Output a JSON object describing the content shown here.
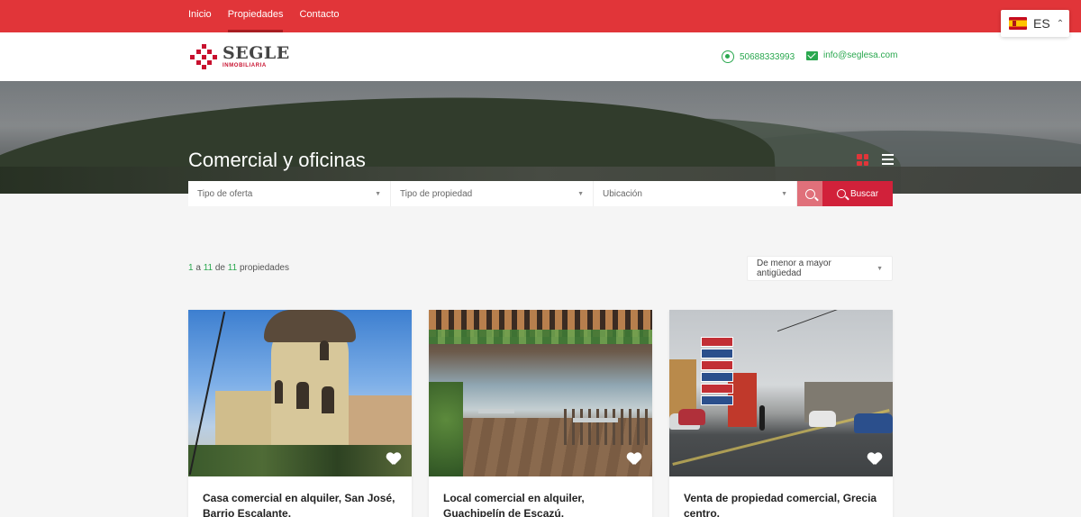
{
  "topnav": {
    "items": [
      {
        "label": "Inicio",
        "active": false
      },
      {
        "label": "Propiedades",
        "active": true
      },
      {
        "label": "Contacto",
        "active": false
      }
    ],
    "accent_color": "#e13539"
  },
  "language": {
    "current": "ES",
    "flag": "spain-flag",
    "alt_flag": "us-flag"
  },
  "header": {
    "logo_name": "SEGLE",
    "logo_sub": "INMOBILIARIA",
    "phone": "50688333993",
    "email": "info@seglesa.com"
  },
  "hero": {
    "title": "Comercial y oficinas"
  },
  "search": {
    "offer_type": "Tipo de oferta",
    "property_type": "Tipo de propiedad",
    "location": "Ubicación",
    "button_label": "Buscar"
  },
  "results": {
    "from": "1",
    "connector_a": "a",
    "to": "11",
    "connector_de": "de",
    "total": "11",
    "suffix": "propiedades"
  },
  "sort": {
    "selected": "De menor a mayor antigüedad"
  },
  "cards": [
    {
      "title": "Casa comercial en alquiler, San José, Barrio Escalante."
    },
    {
      "title": "Local comercial en alquiler, Guachipelín de Escazú."
    },
    {
      "title": "Venta de propiedad comercial, Grecia centro."
    }
  ]
}
